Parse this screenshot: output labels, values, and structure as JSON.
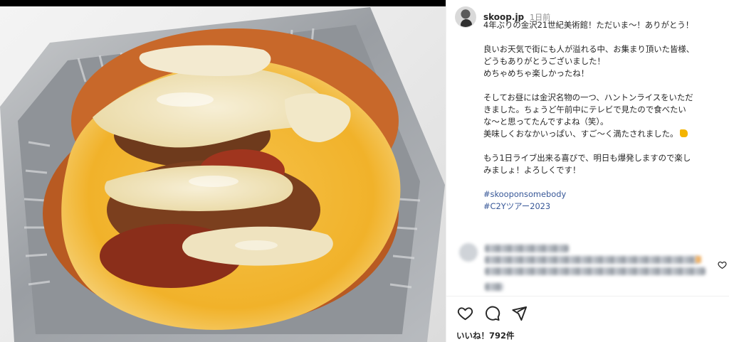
{
  "post": {
    "username": "skoop.jp",
    "timestamp": "1日前",
    "caption_lines": [
      "4年ぶりの金沢21世紀美術館！ただいま〜！ありがとう！",
      "",
      "良いお天気で街にも人が溢れる中、お集まり頂いた皆様、",
      "どうもありがとうございました！",
      "めちゃめちゃ楽しかったね！",
      "",
      "そしてお昼には金沢名物の一つ、ハントンライスをいただ",
      "きました。ちょうど午前中にテレビで見たので食べたい",
      "な〜と思ってたんですよね（笑）。",
      "美味しくおなかいっぱい、すご〜く満たされました。",
      "",
      "もう1日ライブ出来る喜びで、明日も爆発しますので楽し",
      "みましょ！よろしくです！"
    ],
    "hashtags": [
      "#skooponsomebody",
      "#C2Yツアー2023"
    ],
    "likes": "いいね！792件"
  },
  "icons": {
    "like": "heart-icon",
    "comment": "comment-icon",
    "share": "share-icon",
    "comment_like": "small-heart-icon"
  },
  "colors": {
    "hashtag": "#385898",
    "text": "#262626",
    "muted": "#8e8e8e"
  }
}
